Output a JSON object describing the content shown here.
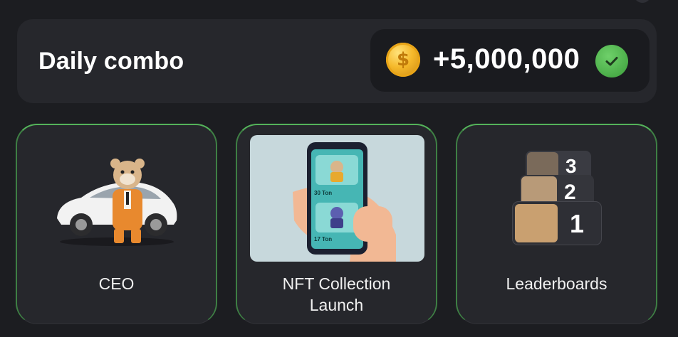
{
  "header": {
    "title": "Daily combo",
    "reward_amount": "+5,000,000",
    "coin_symbol": "$"
  },
  "cards": [
    {
      "label": "CEO",
      "icon": "ceo-hamster-car-icon"
    },
    {
      "label": "NFT Collection\nLaunch",
      "icon": "nft-phone-icon",
      "screen_items": [
        "30 Ton",
        "17 Ton"
      ]
    },
    {
      "label": "Leaderboards",
      "icon": "leaderboard-podium-icon",
      "ranks": [
        "3",
        "2",
        "1"
      ]
    }
  ],
  "colors": {
    "accent_green": "#54b35a",
    "coin_gold": "#f5b82a",
    "background": "#1c1d21"
  }
}
